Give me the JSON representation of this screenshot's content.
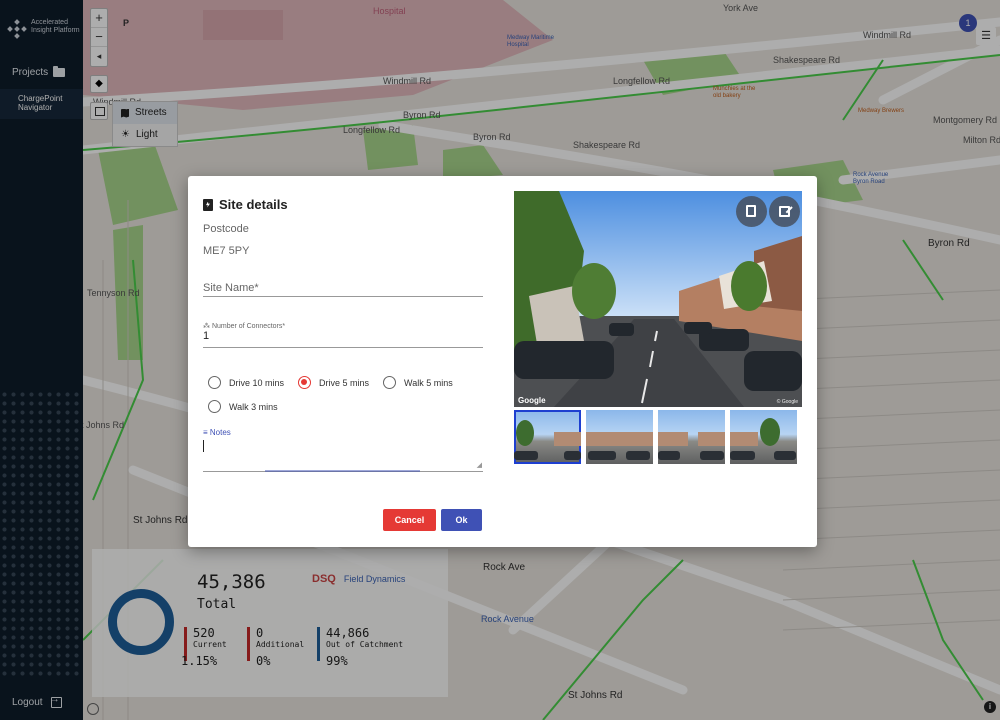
{
  "app": {
    "logo_line1": "Accelerated",
    "logo_line2": "Insight Platform",
    "projects_label": "Projects",
    "nav_item_line1": "ChargePoint",
    "nav_item_line2": "Navigator",
    "logout_label": "Logout"
  },
  "map": {
    "zoom_in": "+",
    "zoom_out": "−",
    "reset_bearing": "◂",
    "layer_options": [
      {
        "label": "Streets",
        "selected": true
      },
      {
        "label": "Light",
        "selected": false
      }
    ],
    "notification_count": "1",
    "labels": [
      "Hospital",
      "Medway Maritime Hospital",
      "Windmill Rd",
      "Windmill Rd",
      "Windmill Rd",
      "Longfellow Rd",
      "Longfellow Rd",
      "Byron Rd",
      "Byron Rd",
      "Byron Rd",
      "Shakespeare Rd",
      "Shakespeare Rd",
      "Tennyson Rd",
      "St Johns Rd",
      "St Johns Rd",
      "St Johns Rd",
      "Rock Ave",
      "Rock Avenue",
      "Milton Rd",
      "Montgomery Rd",
      "Munchies at the old bakery",
      "Medway Brewers",
      "Rock Avenue Byron Road",
      "York Ave",
      "P"
    ]
  },
  "stats": {
    "total_value": "45,386",
    "total_label": "Total",
    "current_value": "520",
    "current_label": "Current",
    "current_pct": "1.15%",
    "additional_value": "0",
    "additional_label": "Additional",
    "additional_pct": "0%",
    "out_value": "44,866",
    "out_label": "Out of Catchment",
    "out_pct": "99%",
    "brand_dsq": "DSQ",
    "brand_fd": "Field Dynamics",
    "colors": {
      "current": "#c62828",
      "additional": "#c62828",
      "out": "#1e5f9a",
      "donut": "#1e5f9a"
    }
  },
  "dialog": {
    "title": "Site details",
    "postcode_label": "Postcode",
    "postcode_value": "ME7 5PY",
    "site_name_placeholder": "Site Name*",
    "connectors_label": "Number of Connectors*",
    "connectors_value": "1",
    "catchment_options": [
      {
        "label": "Drive 10 mins",
        "selected": false
      },
      {
        "label": "Drive 5 mins",
        "selected": true
      },
      {
        "label": "Walk 5 mins",
        "selected": false
      },
      {
        "label": "Walk 3 mins",
        "selected": false
      }
    ],
    "notes_label": "Notes",
    "cancel_label": "Cancel",
    "ok_label": "Ok",
    "photo_credit": "Google",
    "photo_credit_small": "© Google",
    "colors": {
      "primary": "#3f51b5",
      "danger": "#e53935"
    }
  }
}
